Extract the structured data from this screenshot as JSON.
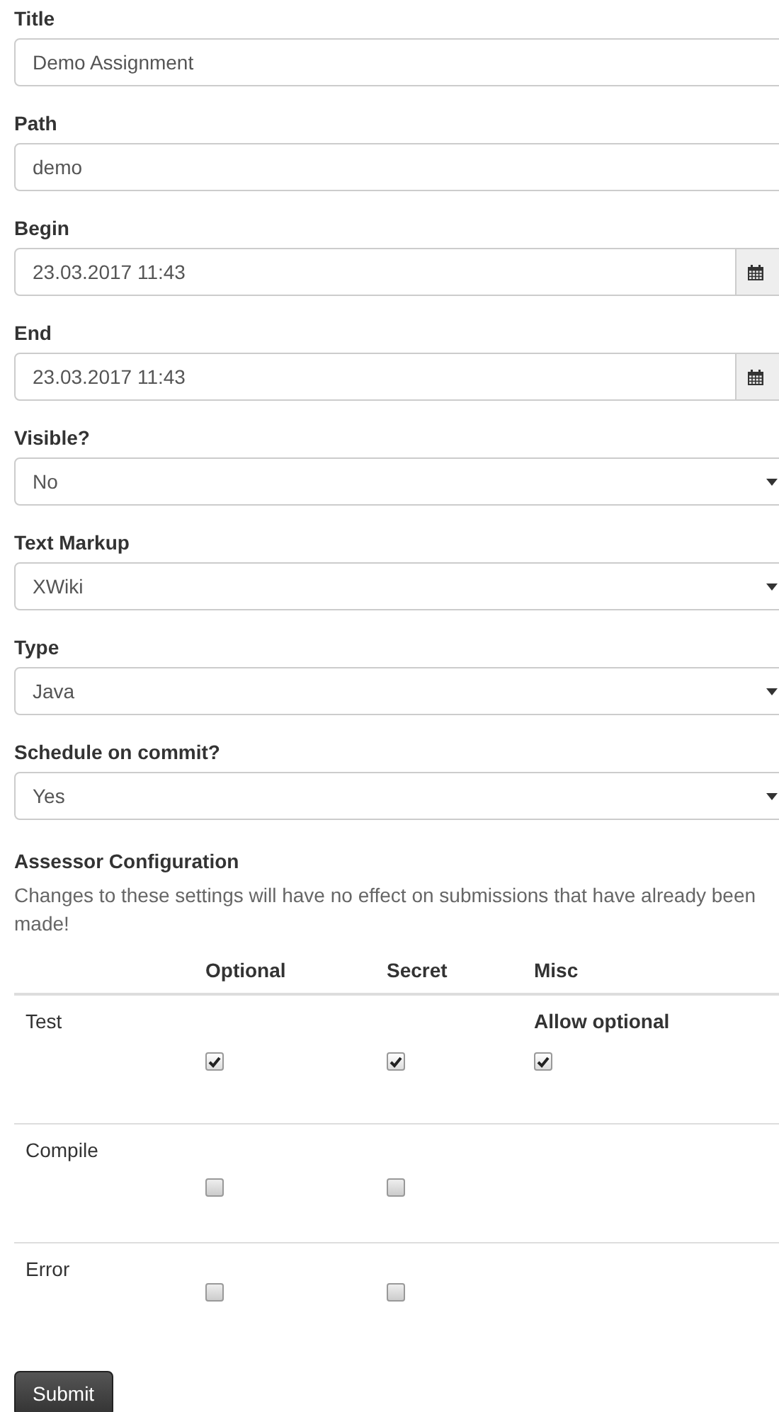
{
  "fields": [
    {
      "kind": "text",
      "label": "Title",
      "value": "Demo Assignment"
    },
    {
      "kind": "text",
      "label": "Path",
      "value": "demo"
    },
    {
      "kind": "date",
      "label": "Begin",
      "value": "23.03.2017 11:43"
    },
    {
      "kind": "date",
      "label": "End",
      "value": "23.03.2017 11:43"
    },
    {
      "kind": "select",
      "label": "Visible?",
      "value": "No"
    },
    {
      "kind": "select",
      "label": "Text Markup",
      "value": "XWiki"
    },
    {
      "kind": "select",
      "label": "Type",
      "value": "Java"
    },
    {
      "kind": "select",
      "label": "Schedule on commit?",
      "value": "Yes"
    }
  ],
  "assessor": {
    "heading": "Assessor Configuration",
    "note": "Changes to these settings will have no effect on submissions that have already been made!",
    "columns": [
      "Optional",
      "Secret",
      "Misc"
    ],
    "rows": [
      {
        "name": "Test",
        "optional": {
          "checked": true
        },
        "secret": {
          "checked": true
        },
        "misc": {
          "label": "Allow optional",
          "checked": true
        }
      },
      {
        "name": "Compile",
        "optional": {
          "checked": false
        },
        "secret": {
          "checked": false
        }
      },
      {
        "name": "Error",
        "optional": {
          "checked": false
        },
        "secret": {
          "checked": false
        }
      }
    ]
  },
  "submit": "Submit"
}
